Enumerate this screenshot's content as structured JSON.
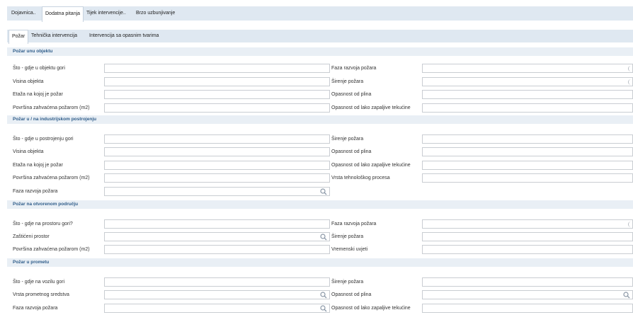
{
  "tabs": [
    "Dojavnica..",
    "Dodatna pitanja",
    "Tijek intervencije..",
    "Brzo uzbunjivanje"
  ],
  "subtabs": [
    "Požar",
    "Tehnička intervencija",
    "Intervencija sa opasnim tvarima"
  ],
  "sections": [
    {
      "title": "Požar unu objektu",
      "rows": [
        {
          "l": "Što - gdje u objektu gori",
          "r": "Faza razvoja požara"
        },
        {
          "l": "Visina objekta",
          "r": "Širenje požara"
        },
        {
          "l": "Etaža na kojoj je požar",
          "r": "Opasnost od plina"
        },
        {
          "l": "Površina zahvaćena požarom (m2)",
          "r": "Opasnost od lako zapaljive tekućine"
        }
      ]
    },
    {
      "title": "Požar u / na industrijskom postrojenju",
      "rows": [
        {
          "l": "Što - gdje u postrojenju gori",
          "r": "Širenje požara"
        },
        {
          "l": "Visina objekta",
          "r": "Opasnost od plina"
        },
        {
          "l": "Etaža na kojoj je požar",
          "r": "Opasnost od lako zapaljive tekućine"
        },
        {
          "l": "Površina zahvaćena požarom (m2)",
          "r": "Vrsta tehnološkog procesa"
        },
        {
          "l": "Faza razvoja požara"
        }
      ]
    },
    {
      "title": "Požar na otvorenom području",
      "rows": [
        {
          "l": "Što - gdje na prostoru gori?",
          "r": "Faza razvoja požara"
        },
        {
          "l": "Zaštićeni prostor",
          "r": "Širenje požara"
        },
        {
          "l": "Površina zahvaćena požarom (m2)",
          "r": "Vremenski uvjeti"
        }
      ]
    },
    {
      "title": "Požar u prometu",
      "rows": [
        {
          "l": "Što - gdje na vozilu gori",
          "r": "Širenje požara"
        },
        {
          "l": "Vrsta prometnog sredstva",
          "r": "Opasnost od plina"
        },
        {
          "l": "Faza razvoja požara",
          "r": "Opasnost od lako zapaljive tekućine"
        }
      ]
    }
  ]
}
